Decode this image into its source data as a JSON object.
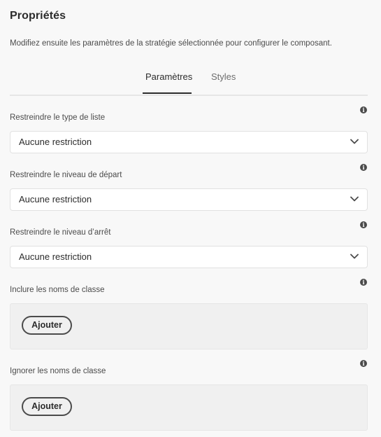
{
  "panel": {
    "title": "Propriétés",
    "description": "Modifiez ensuite les paramètres de la stratégie sélectionnée pour configurer le composant."
  },
  "tabs": [
    {
      "label": "Paramètres",
      "active": true
    },
    {
      "label": "Styles",
      "active": false
    }
  ],
  "fields": {
    "list_type": {
      "label": "Restreindre le type de liste",
      "value": "Aucune restriction"
    },
    "start_level": {
      "label": "Restreindre le niveau de départ",
      "value": "Aucune restriction"
    },
    "stop_level": {
      "label": "Restreindre le niveau d’arrêt",
      "value": "Aucune restriction"
    },
    "include_classes": {
      "label": "Inclure les noms de classe",
      "add_label": "Ajouter"
    },
    "ignore_classes": {
      "label": "Ignorer les noms de classe",
      "add_label": "Ajouter"
    }
  },
  "icons": {
    "info": "info-icon",
    "dropdown": "chevron-down-icon"
  },
  "colors": {
    "background": "#f8f8f8",
    "text": "#2c2c2c",
    "tab_indicator": "#2c2c2c"
  }
}
